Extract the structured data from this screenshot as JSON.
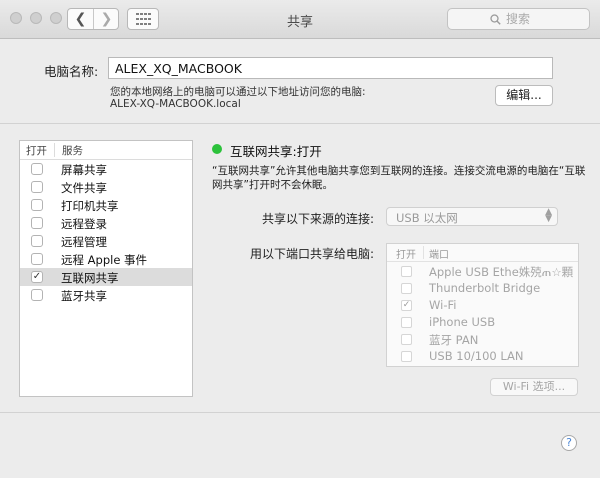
{
  "window": {
    "title": "共享"
  },
  "toolbar": {
    "back_label": "❮",
    "forward_label": "❯",
    "search_placeholder": "搜索"
  },
  "computer_name": {
    "label": "电脑名称:",
    "value": "ALEX_XQ_MACBOOK",
    "desc_line1": "您的本地网络上的电脑可以通过以下地址访问您的电脑:",
    "desc_line2": "ALEX-XQ-MACBOOK.local",
    "edit_button": "编辑..."
  },
  "services": {
    "col_on": "打开",
    "col_service": "服务",
    "items": [
      {
        "label": "屏幕共享",
        "checked": false,
        "selected": false
      },
      {
        "label": "文件共享",
        "checked": false,
        "selected": false
      },
      {
        "label": "打印机共享",
        "checked": false,
        "selected": false
      },
      {
        "label": "远程登录",
        "checked": false,
        "selected": false
      },
      {
        "label": "远程管理",
        "checked": false,
        "selected": false
      },
      {
        "label": "远程 Apple 事件",
        "checked": false,
        "selected": false
      },
      {
        "label": "互联网共享",
        "checked": true,
        "selected": true
      },
      {
        "label": "蓝牙共享",
        "checked": false,
        "selected": false
      }
    ]
  },
  "internet_sharing": {
    "status_title": "互联网共享:打开",
    "status_color": "#2cc23b",
    "desc_line1": "“互联网共享”允许其他电脑共享您到互联网的连接。连接交流电源的电脑在“互联",
    "desc_line2": "网共享”打开时不会休眠。",
    "share_from_label": "共享以下来源的连接:",
    "share_from_value": "USB 以太网",
    "share_to_label": "用以下端口共享给电脑:",
    "ports_col_on": "打开",
    "ports_col_port": "端口",
    "ports": [
      {
        "label": "Apple USB Ethe姝殑ጠ☆顆",
        "checked": false
      },
      {
        "label": "Thunderbolt Bridge",
        "checked": false
      },
      {
        "label": "Wi-Fi",
        "checked": true
      },
      {
        "label": "iPhone USB",
        "checked": false
      },
      {
        "label": "蓝牙 PAN",
        "checked": false
      },
      {
        "label": "USB 10/100 LAN",
        "checked": false
      }
    ],
    "wifi_options_button": "Wi-Fi 选项..."
  },
  "help": {
    "label": "?"
  },
  "check_mark": "✓"
}
